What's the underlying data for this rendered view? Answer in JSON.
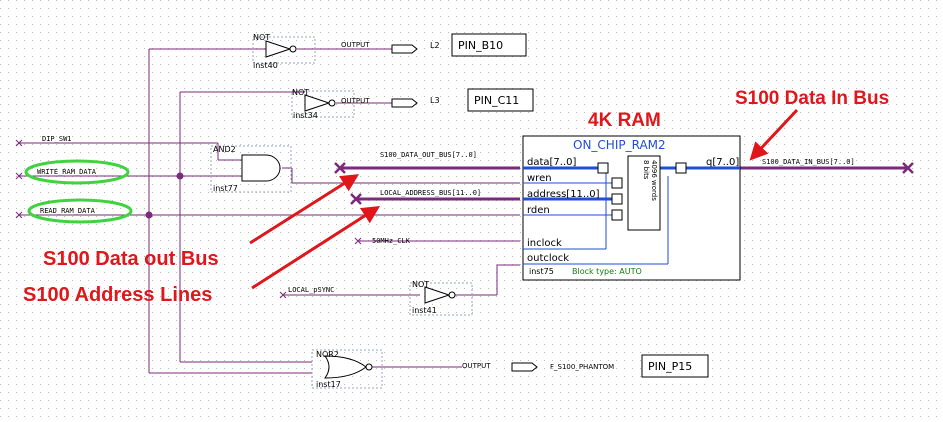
{
  "colors": {
    "wire": "#7a2a7a",
    "bus": "#7a2a7a",
    "port_wire": "#1f4fd6",
    "annotation": "#e0161b",
    "highlight": "#3fd33f",
    "block": "#000000",
    "block_note": "#1a7a1a"
  },
  "annotations": {
    "ram_title": "4K RAM",
    "data_in_bus": "S100 Data In Bus",
    "data_out_bus": "S100 Data out Bus",
    "address_lines": "S100 Address Lines"
  },
  "pins": {
    "b10": {
      "label": "PIN_B10",
      "net": "L2",
      "io": "OUTPUT"
    },
    "c11": {
      "label": "PIN_C11",
      "net": "L3",
      "io": "OUTPUT"
    },
    "p15": {
      "label": "PIN_P15",
      "net": "F_S100_PHANTOM",
      "io": "OUTPUT"
    }
  },
  "gates": {
    "not_inst40": {
      "type": "NOT",
      "inst": "inst40"
    },
    "not_inst34": {
      "type": "NOT",
      "inst": "inst34"
    },
    "and2_inst77": {
      "type": "AND2",
      "inst": "inst77"
    },
    "not_inst41": {
      "type": "NOT",
      "inst": "inst41"
    },
    "nor2_inst17": {
      "type": "NOR2",
      "inst": "inst17"
    }
  },
  "inputs": {
    "dip_sw1": "DIP_SW1",
    "write_ram_data": "WRITE_RAM_DATA",
    "read_ram_data": "READ_RAM_DATA",
    "clk": "50MHz_CLK",
    "psync": "LOCAL_pSYNC"
  },
  "buses": {
    "data_out": "S100_DATA_OUT_BUS[7..0]",
    "address": "LOCAL_ADDRESS_BUS[11..0]",
    "data_in": "S100_DATA_IN_BUS[7..0]"
  },
  "ram": {
    "name": "ON_CHIP_RAM2",
    "inst": "inst75",
    "block_type": "Block type: AUTO",
    "ports": {
      "data": "data[7..0]",
      "wren": "wren",
      "address": "address[11..0]",
      "rden": "rden",
      "inclock": "inclock",
      "outclock": "outclock",
      "q": "q[7..0]"
    },
    "bits": "8 bits",
    "words": "4096 words"
  }
}
